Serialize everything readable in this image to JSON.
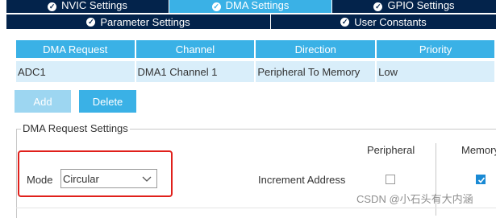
{
  "tabs": {
    "row1": [
      {
        "label": "NVIC Settings",
        "active": false
      },
      {
        "label": "DMA Settings",
        "active": true
      },
      {
        "label": "GPIO Settings",
        "active": false
      }
    ],
    "row2": [
      {
        "label": "Parameter Settings",
        "active": false
      },
      {
        "label": "User Constants",
        "active": false
      }
    ]
  },
  "table": {
    "columns": [
      "DMA Request",
      "Channel",
      "Direction",
      "Priority"
    ],
    "rows": [
      [
        "ADC1",
        "DMA1 Channel 1",
        "Peripheral To Memory",
        "Low"
      ]
    ]
  },
  "buttons": {
    "add": "Add",
    "delete": "Delete"
  },
  "settings": {
    "legend": "DMA Request Settings",
    "peripheral_header": "Peripheral",
    "memory_header": "Memory",
    "mode_label": "Mode",
    "mode_value": "Circular",
    "increment_label": "Increment Address",
    "peripheral_increment_checked": false,
    "memory_increment_checked": true
  },
  "watermark": "CSDN @小石头有大内涵",
  "colors": {
    "tab_dark": "#03234b",
    "accent": "#3ab1e6",
    "highlight_box": "#e0201b"
  }
}
